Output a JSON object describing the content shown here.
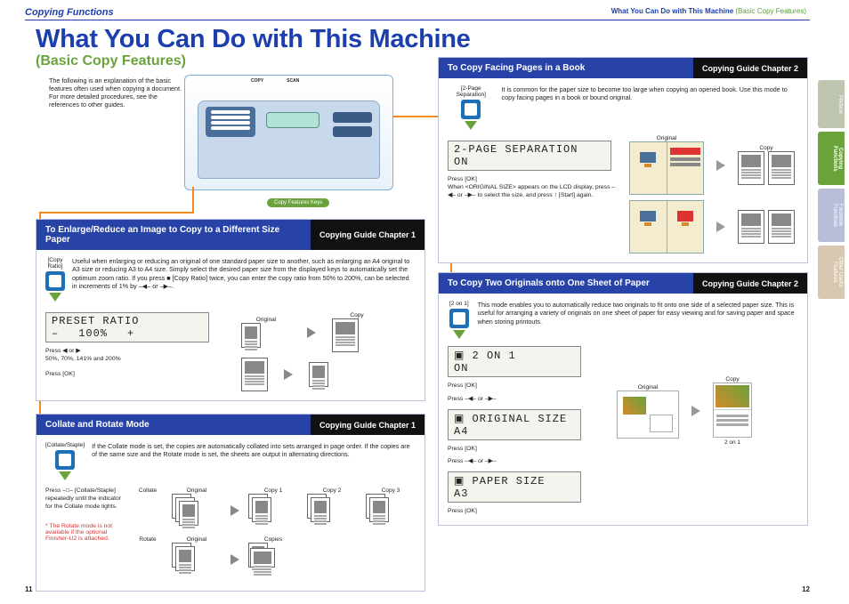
{
  "header": {
    "left": "Copying Functions",
    "right_blue": "What You Can Do with This Machine",
    "right_green": "(Basic Copy Features)"
  },
  "title": "What You Can Do with This Machine",
  "subtitle": "(Basic Copy Features)",
  "intro": "The following is an explanation of the basic features often used when copying a document. For more detailed procedures, see the references to other guides.",
  "machine": {
    "copy": "COPY",
    "scan": "SCAN",
    "features_key": "Copy Features Keys"
  },
  "sections": {
    "enlarge": {
      "title": "To Enlarge/Reduce an Image to Copy to a Different Size Paper",
      "chapter": "Copying  Guide Chapter 1",
      "key": "[Copy Ratio]",
      "desc": "Useful when enlarging or reducing an original of one standard paper size to another, such as enlarging an A4 original to A3 size or reducing A3 to A4 size. Simply select the desired paper size from the displayed keys to automatically set the optimum zoom ratio. If you press ■ [Copy Ratio] twice, you can enter the copy ratio from 50% to 200%, can be selected in increments of 1% by –◀– or –▶–.",
      "lcd_l1": "PRESET RATIO",
      "lcd_minus": "–",
      "lcd_val": "100%",
      "lcd_plus": "+",
      "note1": "Press ◀ or ▶\n50%, 70%, 141% and 200%",
      "note2": "Press [OK]",
      "vis_orig": "Original",
      "vis_copy": "Copy"
    },
    "collate": {
      "title": "Collate and Rotate Mode",
      "chapter": "Copying Guide Chapter 1",
      "key": "[Collate/Staple]",
      "desc": "If the Collate mode is set, the copies are automatically collated into sets arranged in page order. If the copies are of the same size and the Rotate mode is set, the sheets are output in alternating directions.",
      "note1": "Press –□– [Collate/Staple] repeatedly until the indicator for the Collate mode lights.",
      "red_note": "* The Rotate mode is not available if the optional Finisher-U2 is attached.",
      "lbl_collate": "Collate",
      "lbl_rotate": "Rotate",
      "lbl_orig": "Original",
      "lbl_copies": "Copies",
      "lbl_c1": "Copy 1",
      "lbl_c2": "Copy 2",
      "lbl_c3": "Copy 3"
    },
    "facing": {
      "title": "To Copy Facing Pages in a Book",
      "chapter": "Copying Guide Chapter 2",
      "key": "[2-Page Separation]",
      "desc": "It is common for the paper size to become too large when copying an opened book. Use this mode to copy facing pages in a book or bound original.",
      "lcd_l1": "2-PAGE SEPARATION",
      "lcd_l2": "  ON",
      "note1": "Press [OK]\nWhen <ORIGINAL SIZE> appears on the LCD display, press –◀– or –▶– to select the size, and press ↑ [Start] again.",
      "vis_orig": "Original",
      "vis_copy": "Copy"
    },
    "twoon1": {
      "title": "To Copy Two Originals onto One Sheet of Paper",
      "chapter": "Copying Guide Chapter 2",
      "key": "[2 on 1]",
      "desc": "This mode enables you to automatically reduce two originals to fit onto one side of a selected paper size. This is useful for arranging a variety of originals on one sheet of paper for easy viewing and for saving paper and space when storing printouts.",
      "lcd1_l1": "▣ 2 ON 1",
      "lcd1_l2": "  ON",
      "n1": "Press [OK]",
      "n1b": "Press –◀– or –▶–",
      "lcd2_l1": "▣ ORIGINAL SIZE",
      "lcd2_l2": "  A4",
      "n2": "Press [OK]",
      "n2b": "Press –◀– or –▶–",
      "lcd3_l1": "▣ PAPER SIZE",
      "lcd3_l2": "  A3",
      "n3": "Press [OK]",
      "vis_orig": "Original",
      "vis_copy": "Copy",
      "vis_2on1": "2 on 1"
    }
  },
  "tabs": {
    "t1": "Preface",
    "t2": "Copying Functions",
    "t3": "Facsimile Functions",
    "t4": "Other Useful Features"
  },
  "page_left": "11",
  "page_right": "12"
}
